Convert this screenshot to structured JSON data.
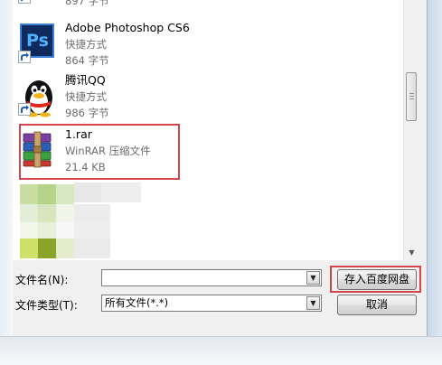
{
  "files": [
    {
      "name": "",
      "type": "",
      "size": "897 字节",
      "icon": "shortcut-file-icon"
    },
    {
      "name": "Adobe Photoshop CS6",
      "type": "快捷方式",
      "size": "864 字节",
      "icon": "photoshop-icon"
    },
    {
      "name": "腾讯QQ",
      "type": "快捷方式",
      "size": "986 字节",
      "icon": "qq-penguin-icon"
    },
    {
      "name": "1.rar",
      "type": "WinRAR 压缩文件",
      "size": "21.4 KB",
      "icon": "winrar-archive-icon"
    }
  ],
  "filename": {
    "label": "文件名(N):",
    "value": ""
  },
  "filetype": {
    "label": "文件类型(T):",
    "value": "所有文件(*.*)"
  },
  "buttons": {
    "save": "存入百度网盘",
    "cancel": "取消"
  },
  "colors": {
    "highlight": "#d1454b",
    "ps_blue": "#1e3a8a",
    "ps_text": "#4fb0ff"
  }
}
